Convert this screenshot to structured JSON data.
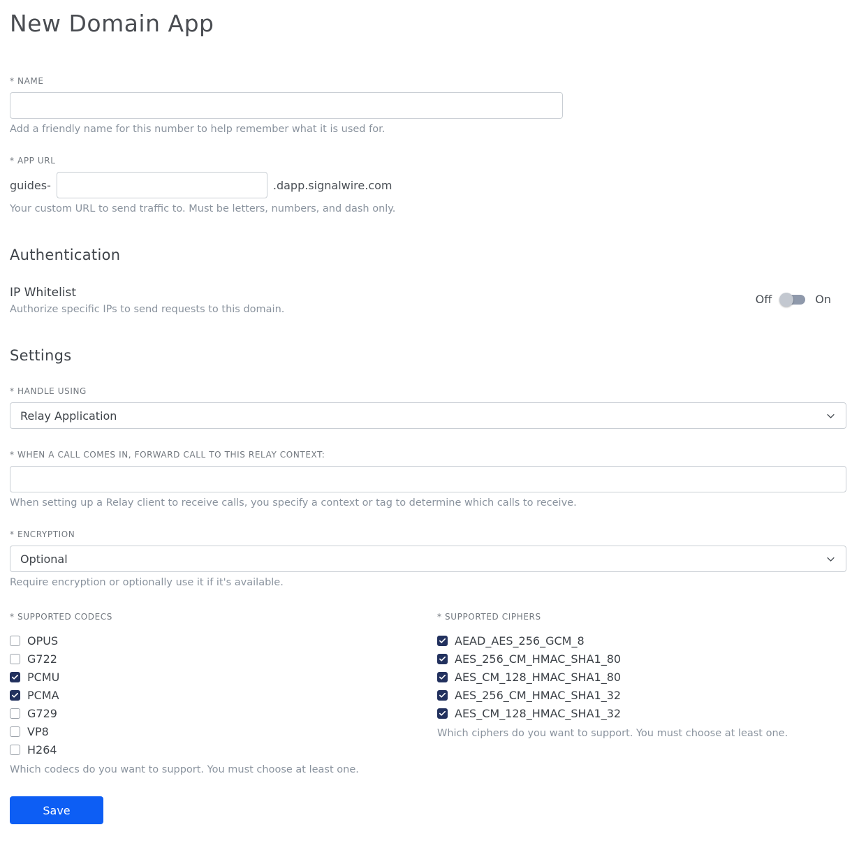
{
  "page": {
    "title": "New Domain App"
  },
  "name_field": {
    "label": "* NAME",
    "value": "",
    "helper": "Add a friendly name for this number to help remember what it is used for."
  },
  "app_url": {
    "label": "* APP URL",
    "prefix": "guides-",
    "value": "",
    "suffix": ".dapp.signalwire.com",
    "helper": "Your custom URL to send traffic to. Must be letters, numbers, and dash only."
  },
  "authentication": {
    "heading": "Authentication",
    "ip_whitelist": {
      "label": "IP Whitelist",
      "helper": "Authorize specific IPs to send requests to this domain.",
      "off_label": "Off",
      "on_label": "On",
      "state": "off"
    }
  },
  "settings": {
    "heading": "Settings",
    "handle_using": {
      "label": "* HANDLE USING",
      "value": "Relay Application"
    },
    "relay_context": {
      "label": "* WHEN A CALL COMES IN, FORWARD CALL TO THIS RELAY CONTEXT:",
      "value": "",
      "helper": "When setting up a Relay client to receive calls, you specify a context or tag to determine which calls to receive."
    },
    "encryption": {
      "label": "* ENCRYPTION",
      "value": "Optional",
      "helper": "Require encryption or optionally use it if it's available."
    },
    "codecs": {
      "label": "* SUPPORTED CODECS",
      "items": [
        {
          "label": "OPUS",
          "checked": false
        },
        {
          "label": "G722",
          "checked": false
        },
        {
          "label": "PCMU",
          "checked": true
        },
        {
          "label": "PCMA",
          "checked": true
        },
        {
          "label": "G729",
          "checked": false
        },
        {
          "label": "VP8",
          "checked": false
        },
        {
          "label": "H264",
          "checked": false
        }
      ],
      "helper": "Which codecs do you want to support. You must choose at least one."
    },
    "ciphers": {
      "label": "* SUPPORTED CIPHERS",
      "items": [
        {
          "label": "AEAD_AES_256_GCM_8",
          "checked": true
        },
        {
          "label": "AES_256_CM_HMAC_SHA1_80",
          "checked": true
        },
        {
          "label": "AES_CM_128_HMAC_SHA1_80",
          "checked": true
        },
        {
          "label": "AES_256_CM_HMAC_SHA1_32",
          "checked": true
        },
        {
          "label": "AES_CM_128_HMAC_SHA1_32",
          "checked": true
        }
      ],
      "helper": "Which ciphers do you want to support. You must choose at least one."
    }
  },
  "actions": {
    "save_label": "Save"
  },
  "colors": {
    "accent_blue": "#0d5ef4",
    "checkbox_checked": "#22315e",
    "helper_gray": "#8a939e"
  }
}
